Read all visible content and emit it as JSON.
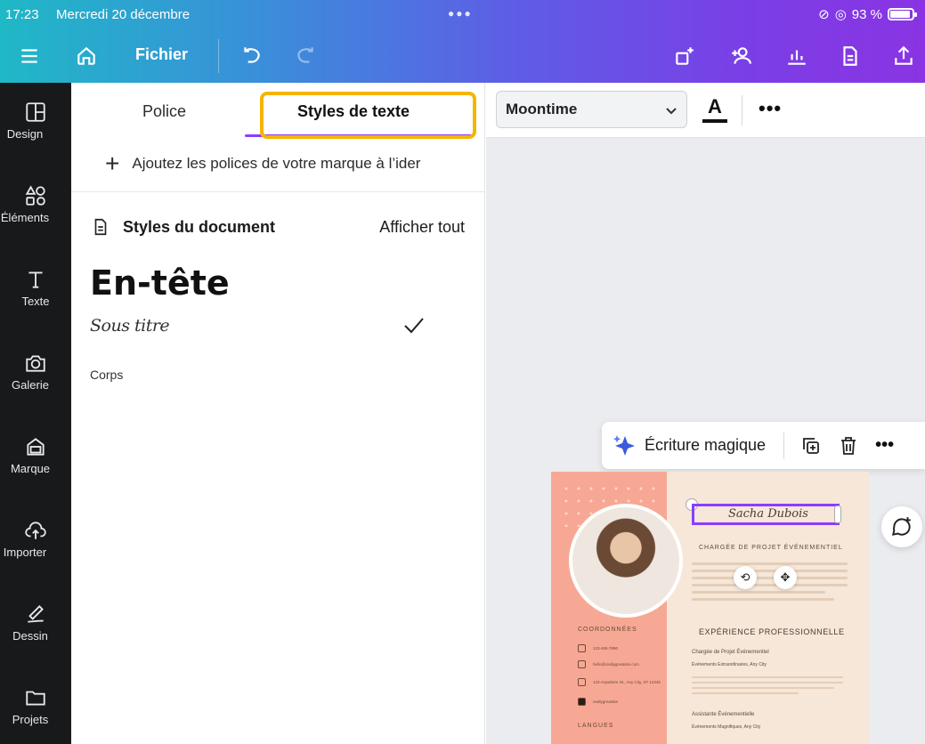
{
  "status_bar": {
    "time": "17:23",
    "date": "Mercredi 20 décembre",
    "battery": "93 %"
  },
  "toolbar": {
    "file_label": "Fichier"
  },
  "rail": {
    "items": [
      {
        "label": "Design",
        "icon": "layout-icon"
      },
      {
        "label": "Éléments",
        "icon": "shapes-icon"
      },
      {
        "label": "Texte",
        "icon": "text-icon"
      },
      {
        "label": "Galerie",
        "icon": "camera-icon"
      },
      {
        "label": "Marque",
        "icon": "brand-icon"
      },
      {
        "label": "Importer",
        "icon": "cloud-upload-icon"
      },
      {
        "label": "Dessin",
        "icon": "draw-icon"
      },
      {
        "label": "Projets",
        "icon": "folder-icon"
      }
    ]
  },
  "panel": {
    "tabs": [
      {
        "label": "Police"
      },
      {
        "label": "Styles de texte"
      }
    ],
    "add_brand_fonts": "Ajoutez les polices de votre marque à l’ider",
    "doc_styles_title": "Styles du document",
    "show_all": "Afficher tout",
    "styles": {
      "heading": "En-tête",
      "subtitle": "Sous titre",
      "body": "Corps"
    }
  },
  "editor": {
    "font_name": "Moontime",
    "magic_write": "Écriture magique"
  },
  "resume": {
    "name": "Sacha Dubois",
    "subtitle": "CHARGÉE DE PROJET ÉVÉNEMENTIEL",
    "contacts_title": "COORDONNÉES",
    "contacts": [
      "123-456-7890",
      "hello@reallygreatsite.com",
      "123 Anywhere St., Any City, ST 12345",
      "reallygreatsite"
    ],
    "experience_title": "EXPÉRIENCE PROFESSIONNELLE",
    "job1_title": "Chargée de Projet Événementiel",
    "job1_company": "Événements Extraordinaires, Any City",
    "job2_title": "Assistante Événementielle",
    "job2_company": "Événements Magnifiques, Any City",
    "languages_title": "LANGUES"
  },
  "colors": {
    "accent": "#8b3dff",
    "highlight": "#f6b400",
    "rail_bg": "#18191b",
    "resume_left": "#f7a894",
    "resume_right": "#f6e7d8"
  }
}
